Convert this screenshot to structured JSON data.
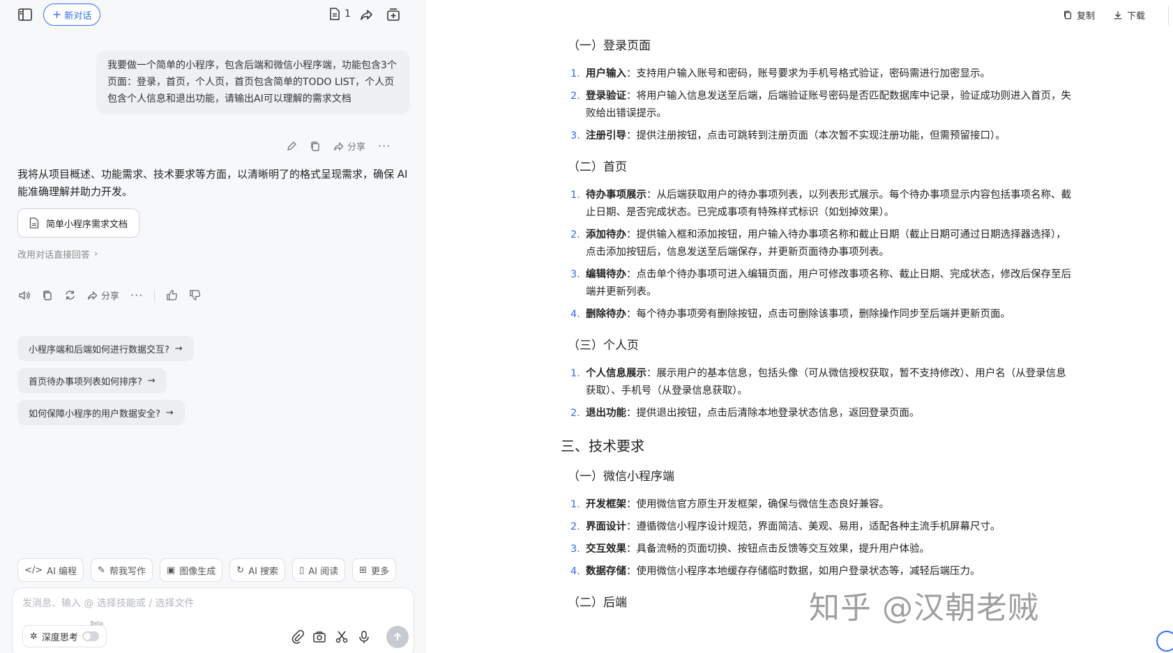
{
  "header": {
    "new_chat_label": "新对话",
    "doc_count": "1"
  },
  "user_message": "我要做一个简单的小程序，包含后端和微信小程序端，功能包含3个页面：登录，首页，个人页，首页包含简单的TODO LIST，个人页包含个人信息和退出功能，请输出AI可以理解的需求文档",
  "message_actions": {
    "share_label": "分享"
  },
  "ai_reply": {
    "text": "我将从项目概述、功能需求、技术要求等方面，以清晰明了的格式呈现需求，确保 AI 能准确理解并助力开发。",
    "doc_card_title": "简单小程序需求文档",
    "switch_link": "改用对话直接回答",
    "share_label": "分享"
  },
  "suggestions": [
    "小程序端和后端如何进行数据交互?",
    "首页待办事项列表如何排序?",
    "如何保障小程序的用户数据安全?"
  ],
  "skills": [
    "AI 编程",
    "帮我写作",
    "图像生成",
    "AI 搜索",
    "AI 阅读",
    "更多"
  ],
  "composer": {
    "placeholder": "发消息、输入 @ 选择技能或 / 选择文件",
    "deep_think_label": "深度思考",
    "beta_label": "Beta"
  },
  "document_tools": {
    "copy_label": "复制",
    "download_label": "下载"
  },
  "document": {
    "sections": [
      {
        "title": "（一）登录页面",
        "items": [
          {
            "num": "1.",
            "term": "用户输入",
            "text": "：支持用户输入账号和密码，账号要求为手机号格式验证，密码需进行加密显示。"
          },
          {
            "num": "2.",
            "term": "登录验证",
            "text": "：将用户输入信息发送至后端，后端验证账号密码是否匹配数据库中记录，验证成功则进入首页，失败给出错误提示。"
          },
          {
            "num": "3.",
            "term": "注册引导",
            "text": "：提供注册按钮，点击可跳转到注册页面（本次暂不实现注册功能，但需预留接口）。"
          }
        ]
      },
      {
        "title": "（二）首页",
        "items": [
          {
            "num": "1.",
            "term": "待办事项展示",
            "text": "：从后端获取用户的待办事项列表，以列表形式展示。每个待办事项显示内容包括事项名称、截止日期、是否完成状态。已完成事项有特殊样式标识（如划掉效果）。"
          },
          {
            "num": "2.",
            "term": "添加待办",
            "text": "：提供输入框和添加按钮，用户输入待办事项名称和截止日期（截止日期可通过日期选择器选择），点击添加按钮后，信息发送至后端保存，并更新页面待办事项列表。"
          },
          {
            "num": "3.",
            "term": "编辑待办",
            "text": "：点击单个待办事项可进入编辑页面，用户可修改事项名称、截止日期、完成状态，修改后保存至后端并更新列表。"
          },
          {
            "num": "4.",
            "term": "删除待办",
            "text": "：每个待办事项旁有删除按钮，点击可删除该事项，删除操作同步至后端并更新页面。"
          }
        ]
      },
      {
        "title": "（三）个人页",
        "items": [
          {
            "num": "1.",
            "term": "个人信息展示",
            "text": "：展示用户的基本信息，包括头像（可从微信授权获取，暂不支持修改）、用户名（从登录信息获取）、手机号（从登录信息获取）。"
          },
          {
            "num": "2.",
            "term": "退出功能",
            "text": "：提供退出按钮，点击后清除本地登录状态信息，返回登录页面。"
          }
        ]
      }
    ],
    "heading_tech": "三、技术要求",
    "tech_sub1": "（一）微信小程序端",
    "tech_items": [
      {
        "num": "1.",
        "term": "开发框架",
        "text": "：使用微信官方原生开发框架，确保与微信生态良好兼容。"
      },
      {
        "num": "2.",
        "term": "界面设计",
        "text": "：遵循微信小程序设计规范，界面简洁、美观、易用，适配各种主流手机屏幕尺寸。"
      },
      {
        "num": "3.",
        "term": "交互效果",
        "text": "：具备流畅的页面切换、按钮点击反馈等交互效果，提升用户体验。"
      },
      {
        "num": "4.",
        "term": "数据存储",
        "text": "：使用微信小程序本地缓存存储临时数据，如用户登录状态等，减轻后端压力。"
      }
    ],
    "tech_sub2": "（二）后端"
  },
  "watermark": "知乎 @汉朝老贼",
  "colors": {
    "accent": "#2f6bff",
    "panel_bg": "#f7f8fa"
  }
}
